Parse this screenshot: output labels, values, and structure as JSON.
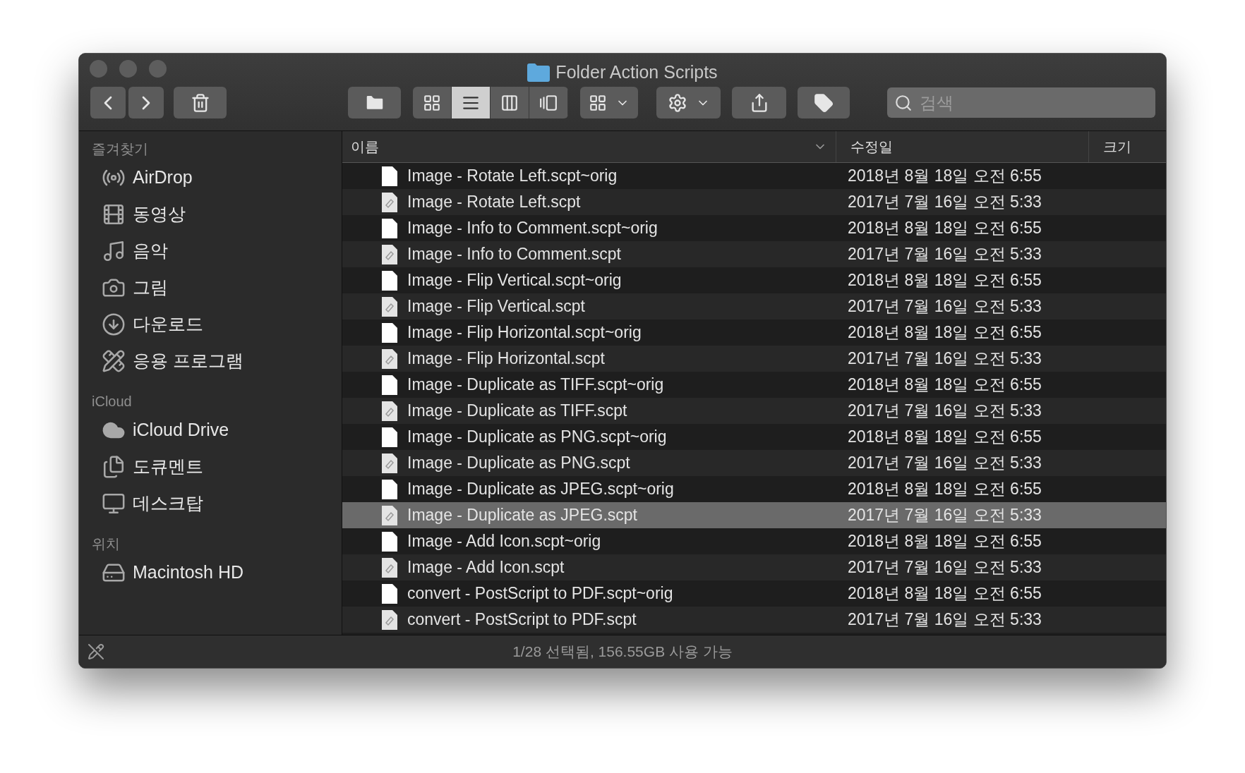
{
  "window": {
    "title": "Folder Action Scripts"
  },
  "toolbar": {
    "view_modes": [
      {
        "kind": "icons",
        "selected": false
      },
      {
        "kind": "list",
        "selected": true
      },
      {
        "kind": "columns",
        "selected": false
      },
      {
        "kind": "gallery",
        "selected": false
      }
    ],
    "search": {
      "placeholder": "검색"
    }
  },
  "sidebar": {
    "sections": [
      {
        "title": "즐겨찾기",
        "items": [
          {
            "label": "AirDrop",
            "kind": "airdrop"
          },
          {
            "label": "동영상",
            "kind": "movies"
          },
          {
            "label": "음악",
            "kind": "music"
          },
          {
            "label": "그림",
            "kind": "pictures"
          },
          {
            "label": "다운로드",
            "kind": "downloads"
          },
          {
            "label": "응용 프로그램",
            "kind": "apps"
          }
        ]
      },
      {
        "title": "iCloud",
        "items": [
          {
            "label": "iCloud Drive",
            "kind": "cloud"
          },
          {
            "label": "도큐멘트",
            "kind": "documents"
          },
          {
            "label": "데스크탑",
            "kind": "desktop"
          }
        ]
      },
      {
        "title": "위치",
        "items": [
          {
            "label": "Macintosh HD",
            "kind": "disk"
          }
        ]
      }
    ]
  },
  "table": {
    "columns": [
      {
        "label": "이름",
        "sorted": true
      },
      {
        "label": "수정일",
        "sorted": false
      },
      {
        "label": "크기",
        "sorted": false
      }
    ],
    "rows": [
      {
        "name": "Image - Rotate Left.scpt~orig",
        "modified": "2018년 8월 18일 오전 6:55",
        "kind": "document",
        "selected": false
      },
      {
        "name": "Image - Rotate Left.scpt",
        "modified": "2017년 7월 16일 오전 5:33",
        "kind": "script",
        "selected": false
      },
      {
        "name": "Image - Info to Comment.scpt~orig",
        "modified": "2018년 8월 18일 오전 6:55",
        "kind": "document",
        "selected": false
      },
      {
        "name": "Image - Info to Comment.scpt",
        "modified": "2017년 7월 16일 오전 5:33",
        "kind": "script",
        "selected": false
      },
      {
        "name": "Image - Flip Vertical.scpt~orig",
        "modified": "2018년 8월 18일 오전 6:55",
        "kind": "document",
        "selected": false
      },
      {
        "name": "Image - Flip Vertical.scpt",
        "modified": "2017년 7월 16일 오전 5:33",
        "kind": "script",
        "selected": false
      },
      {
        "name": "Image - Flip Horizontal.scpt~orig",
        "modified": "2018년 8월 18일 오전 6:55",
        "kind": "document",
        "selected": false
      },
      {
        "name": "Image - Flip Horizontal.scpt",
        "modified": "2017년 7월 16일 오전 5:33",
        "kind": "script",
        "selected": false
      },
      {
        "name": "Image - Duplicate as TIFF.scpt~orig",
        "modified": "2018년 8월 18일 오전 6:55",
        "kind": "document",
        "selected": false
      },
      {
        "name": "Image - Duplicate as TIFF.scpt",
        "modified": "2017년 7월 16일 오전 5:33",
        "kind": "script",
        "selected": false
      },
      {
        "name": "Image - Duplicate as PNG.scpt~orig",
        "modified": "2018년 8월 18일 오전 6:55",
        "kind": "document",
        "selected": false
      },
      {
        "name": "Image - Duplicate as PNG.scpt",
        "modified": "2017년 7월 16일 오전 5:33",
        "kind": "script",
        "selected": false
      },
      {
        "name": "Image - Duplicate as JPEG.scpt~orig",
        "modified": "2018년 8월 18일 오전 6:55",
        "kind": "document",
        "selected": false
      },
      {
        "name": "Image - Duplicate as JPEG.scpt",
        "modified": "2017년 7월 16일 오전 5:33",
        "kind": "script",
        "selected": true
      },
      {
        "name": "Image - Add Icon.scpt~orig",
        "modified": "2018년 8월 18일 오전 6:55",
        "kind": "document",
        "selected": false
      },
      {
        "name": "Image - Add Icon.scpt",
        "modified": "2017년 7월 16일 오전 5:33",
        "kind": "script",
        "selected": false
      },
      {
        "name": "convert - PostScript to PDF.scpt~orig",
        "modified": "2018년 8월 18일 오전 6:55",
        "kind": "document",
        "selected": false
      },
      {
        "name": "convert - PostScript to PDF.scpt",
        "modified": "2017년 7월 16일 오전 5:33",
        "kind": "script",
        "selected": false
      }
    ]
  },
  "status_bar": {
    "text": "1/28 선택됨, 156.55GB 사용 가능"
  }
}
